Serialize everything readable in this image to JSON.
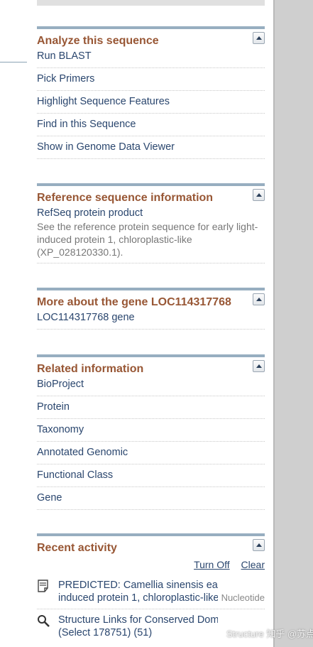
{
  "analyze": {
    "title": "Analyze this sequence",
    "items": [
      "Run BLAST",
      "Pick Primers",
      "Highlight Sequence Features",
      "Find in this Sequence",
      "Show in Genome Data Viewer"
    ]
  },
  "refseq": {
    "title": "Reference sequence information",
    "link": "RefSeq protein product",
    "description": "See the reference protein sequence for early light-induced protein 1, chloroplastic-like (XP_028120330.1)."
  },
  "gene": {
    "title": "More about the gene LOC114317768",
    "link": "LOC114317768 gene"
  },
  "related": {
    "title": "Related information",
    "items": [
      "BioProject",
      "Protein",
      "Taxonomy",
      "Annotated Genomic",
      "Functional Class",
      "Gene"
    ]
  },
  "recent": {
    "title": "Recent activity",
    "turn_off": "Turn Off",
    "clear": "Clear",
    "entries": [
      {
        "line1": "PREDICTED: Camellia sinensis early light-",
        "line2": "induced protein 1, chloroplastic-like",
        "type": "Nucleotide",
        "icon": "document-icon"
      },
      {
        "line1": "Structure Links for Conserved Domains",
        "line2": "(Select 178751) (51)",
        "type": "Structure",
        "icon": "magnifier-icon"
      }
    ]
  },
  "watermark": "知乎 @苏点点"
}
